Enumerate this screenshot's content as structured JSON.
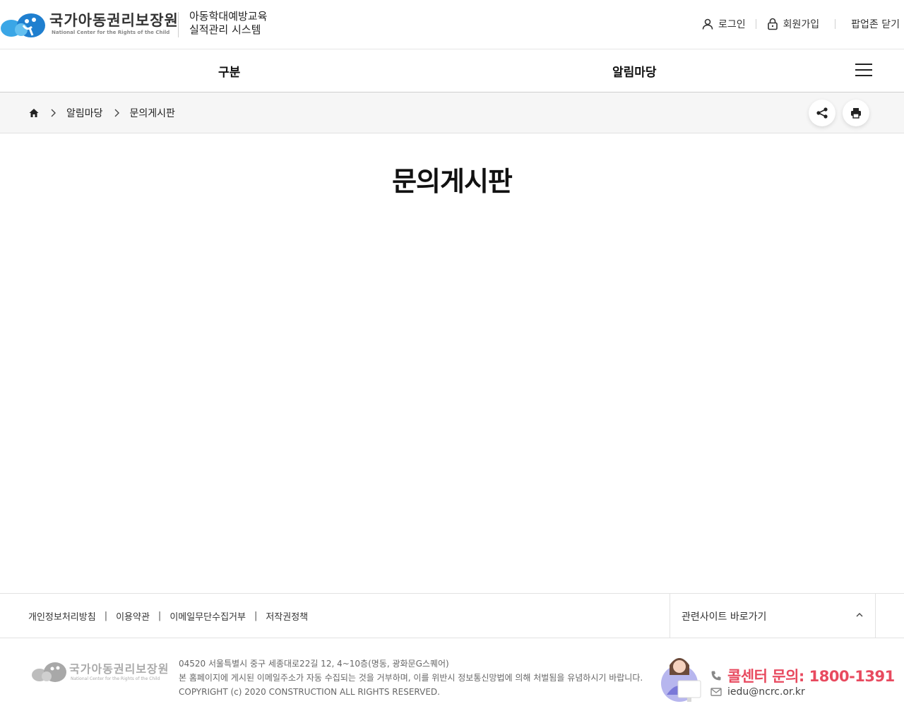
{
  "header": {
    "logo_text_ko": "국가아동권리보장원",
    "logo_text_en": "National Center for the Rights of the Child",
    "system_title_line1": "아동학대예방교육",
    "system_title_line2": "실적관리 시스템",
    "util": {
      "login": "로그인",
      "signup": "회원가입",
      "popup_close": "팝업존 닫기"
    }
  },
  "gnb": {
    "items": [
      {
        "label": "구분"
      },
      {
        "label": "알림마당"
      }
    ]
  },
  "breadcrumb": {
    "items": [
      "알림마당",
      "문의게시판"
    ]
  },
  "page": {
    "title": "문의게시판"
  },
  "footer": {
    "links": [
      "개인정보처리방침",
      "이용약관",
      "이메일무단수집거부",
      "저작권정책"
    ],
    "related_sites": "관련사이트 바로가기",
    "address": "04520 서울특별시 중구 세종대로22길 12, 4~10층(명동, 광화문G스퀘어)",
    "notice": "본 홈페이지에 게시된 이메일주소가 자동 수집되는 것을 거부하며, 이를 위반시 정보통신망법에 의해 처벌됨을 유념하시기 바랍니다.",
    "copyright": "COPYRIGHT (c) 2020 CONSTRUCTION ALL RIGHTS RESERVED.",
    "callcenter": "콜센터 문의: 1800-1391",
    "email": "iedu@ncrc.or.kr"
  },
  "colors": {
    "accent": "#e84a5f",
    "logo_blue": "#2a8fd6"
  }
}
